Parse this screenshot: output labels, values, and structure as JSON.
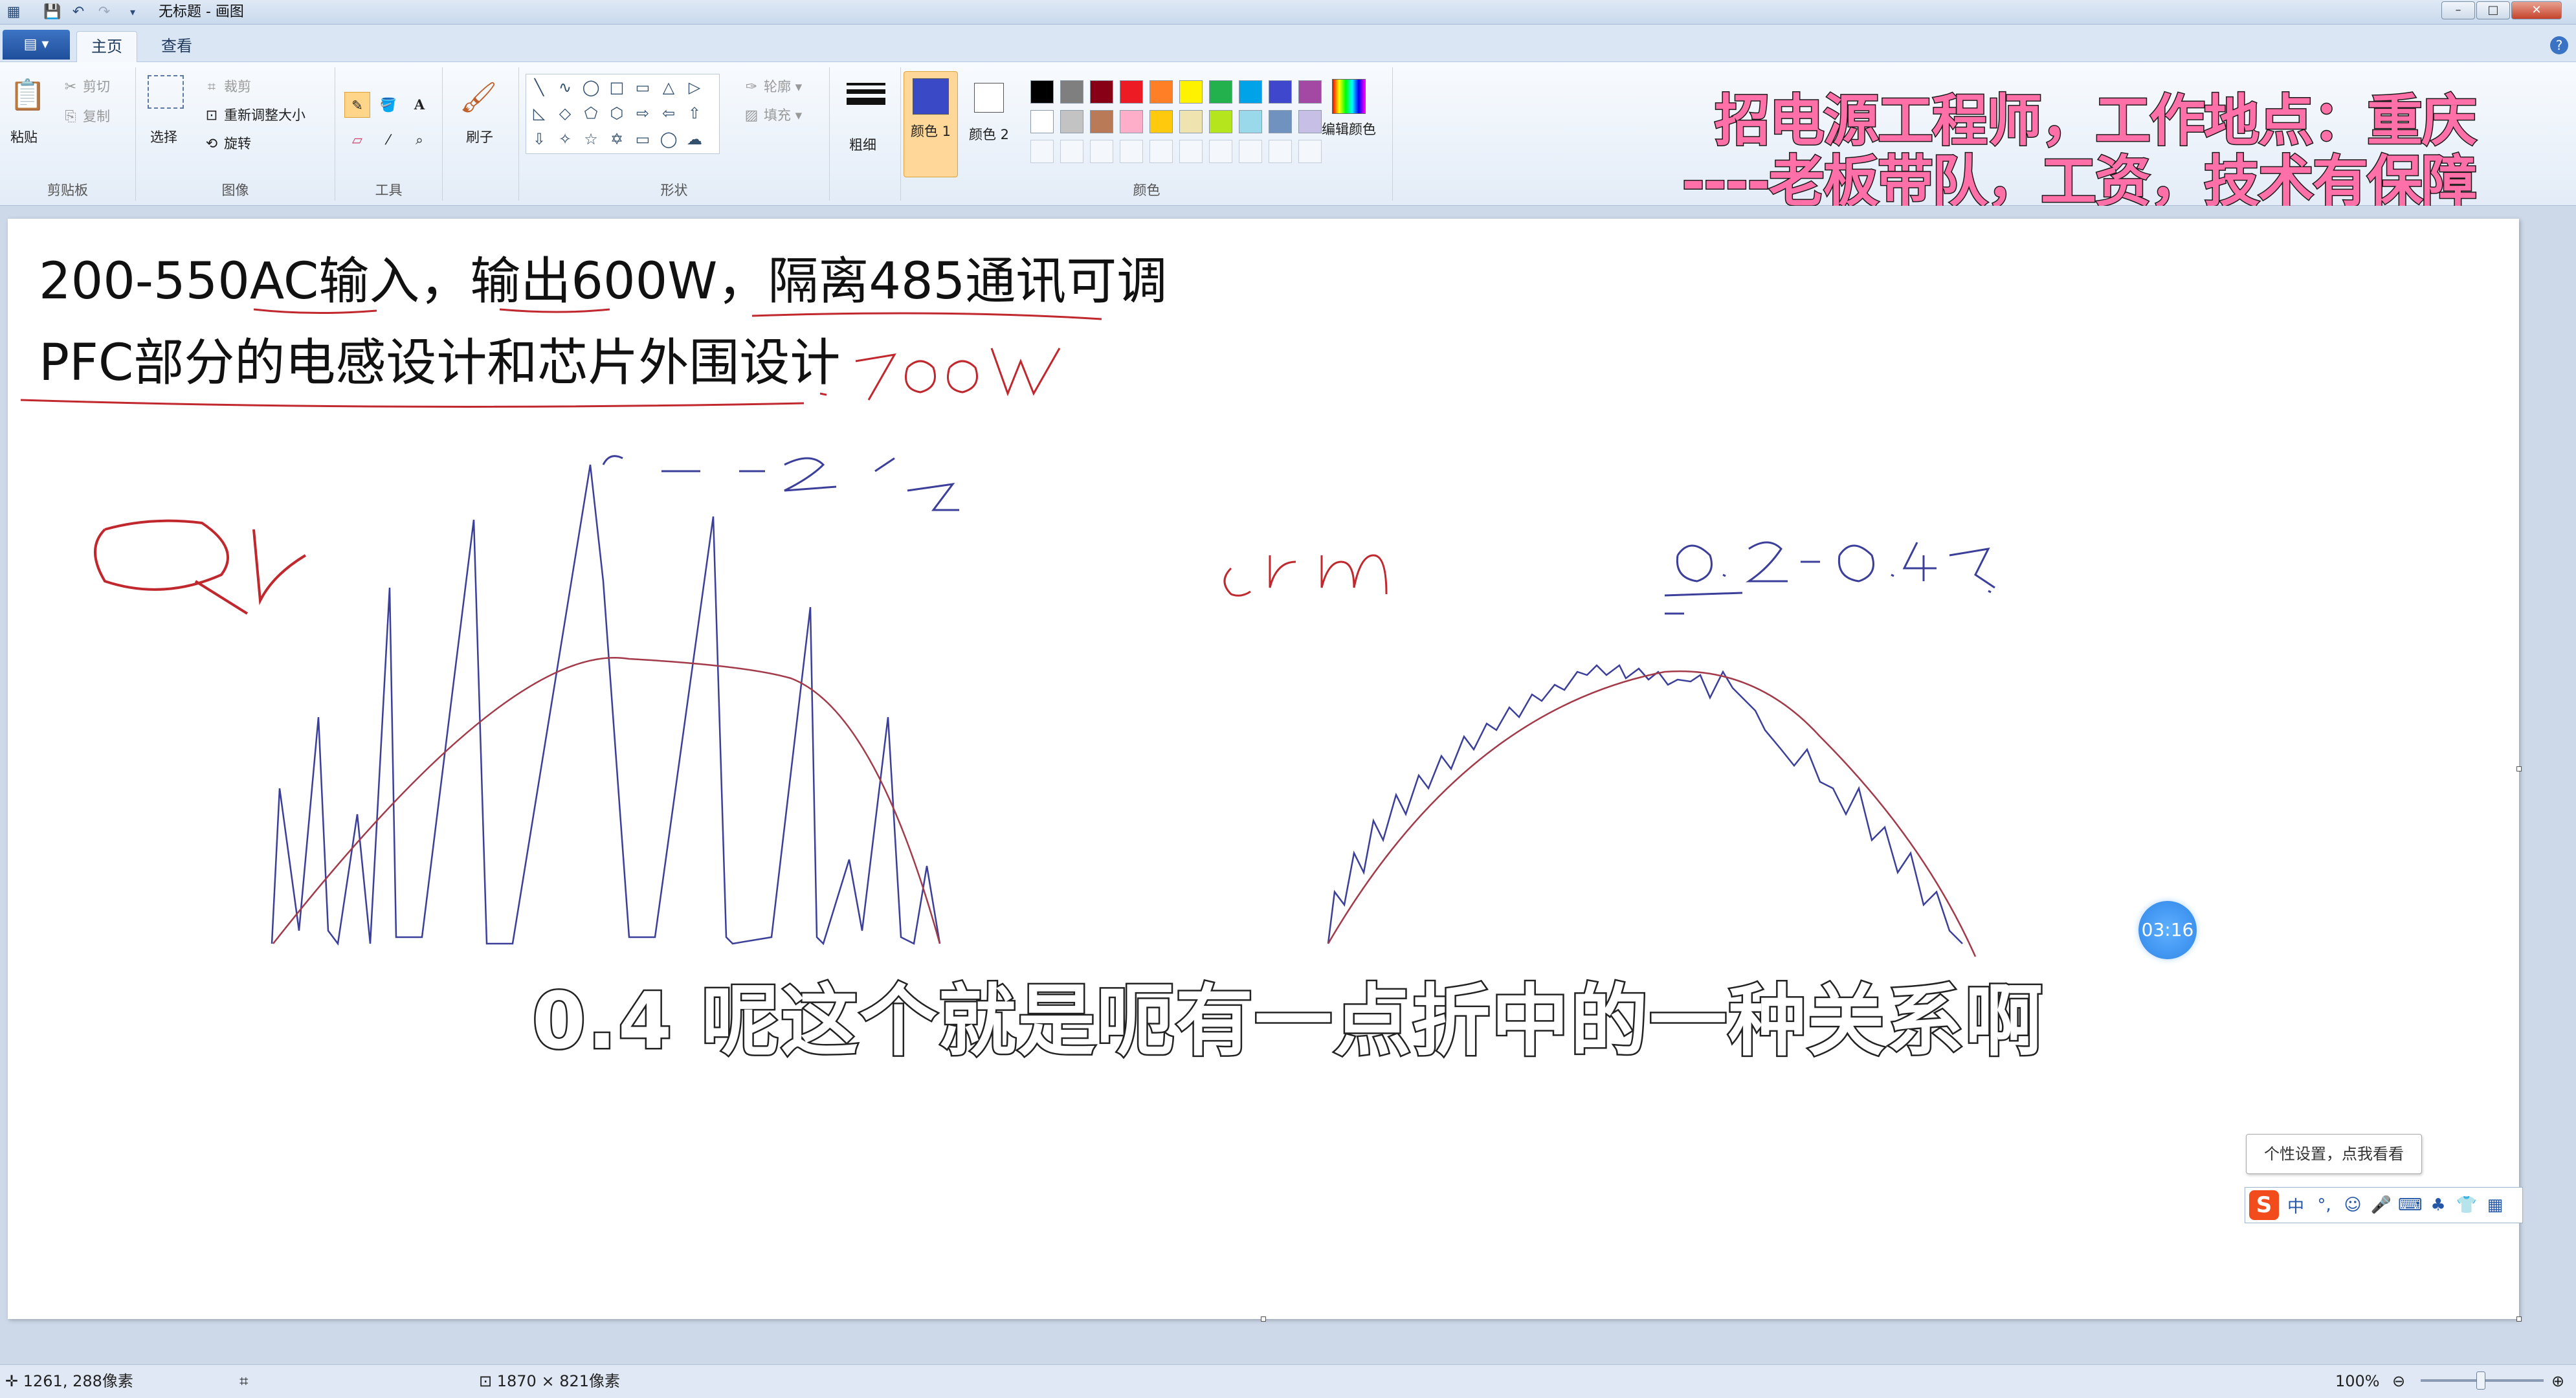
{
  "window": {
    "title": "无标题 - 画图",
    "controls": [
      "–",
      "□",
      "✕"
    ]
  },
  "tabs": {
    "file_menu": "▤ ▾",
    "home": "主页",
    "view": "查看",
    "help": "?"
  },
  "ribbon": {
    "clipboard": {
      "label": "剪贴板",
      "paste": "粘贴",
      "cut": "剪切",
      "copy": "复制"
    },
    "image": {
      "label": "图像",
      "select": "选择",
      "crop": "裁剪",
      "resize": "重新调整大小",
      "rotate": "旋转"
    },
    "tools": {
      "label": "工具"
    },
    "brushes": {
      "label": "刷子"
    },
    "shapes": {
      "label": "形状",
      "outline": "轮廓",
      "fill": "填充",
      "glyphs": [
        "╲",
        "∿",
        "◯",
        "□",
        "▭",
        "△",
        "▷",
        "◺",
        "◇",
        "⬠",
        "⬡",
        "⇨",
        "⇦",
        "⇧",
        "⇩",
        "✧",
        "☆",
        "✡",
        "▭",
        "◯",
        "☁"
      ]
    },
    "size": {
      "label": "粗细"
    },
    "colors": {
      "label": "颜色",
      "color1": "颜色 1",
      "color2": "颜色 2",
      "color1_value": "#3a49c6",
      "color2_value": "#ffffff",
      "edit": "编辑颜色",
      "palette_row1": [
        "#000000",
        "#7f7f7f",
        "#880015",
        "#ed1c24",
        "#ff7f27",
        "#fff200",
        "#22b14c",
        "#00a2e8",
        "#3f48cc",
        "#a349a4"
      ],
      "palette_row2": [
        "#ffffff",
        "#c3c3c3",
        "#b97a57",
        "#ffaec9",
        "#ffc90e",
        "#efe4b0",
        "#b5e61d",
        "#99d9ea",
        "#7092be",
        "#c8bfe7"
      ]
    }
  },
  "banner": {
    "line1": "招电源工程师，工作地点：重庆",
    "line2": "----老板带队，工资，技术有保障"
  },
  "canvas": {
    "line1": "200-550AC输入，输出600W，隔离485通讯可调",
    "line2": "PFC部分的电感设计和芯片外围设计"
  },
  "subtitle": "0.4 呢这个就是呃有一点折中的一种关系啊",
  "timer": "03:16",
  "ime": {
    "tooltip": "个性设置，点我看看",
    "logo": "S",
    "items": [
      "中",
      "°,",
      "☺",
      "🎤",
      "⌨",
      "♣",
      "👕",
      "▦"
    ]
  },
  "status": {
    "cursor_pos": "1261, 288像素",
    "selection": "",
    "canvas_size": "1870 × 821像素",
    "zoom": "100%"
  }
}
